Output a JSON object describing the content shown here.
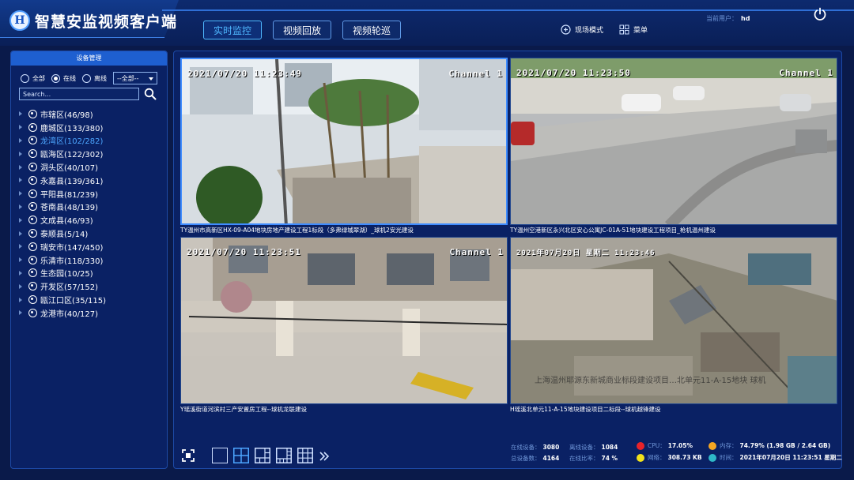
{
  "header": {
    "logo_letter": "H",
    "title": "智慧安监视频客户端",
    "tabs": [
      {
        "label": "实时监控",
        "active": true
      },
      {
        "label": "视频回放",
        "active": false
      },
      {
        "label": "视频轮巡",
        "active": false
      }
    ],
    "scene_mode": "现场模式",
    "menu": "菜单",
    "current_user_label": "当前用户：",
    "current_user": "hd"
  },
  "sidebar": {
    "title": "设备管理",
    "filters": [
      {
        "label": "全部",
        "selected": false
      },
      {
        "label": "在线",
        "selected": true
      },
      {
        "label": "离线",
        "selected": false
      }
    ],
    "select_value": "--全部--",
    "search_placeholder": "Search...",
    "tree": [
      {
        "label": "市辖区(46/98)",
        "selected": false
      },
      {
        "label": "鹿城区(133/380)",
        "selected": false
      },
      {
        "label": "龙湾区(102/282)",
        "selected": true
      },
      {
        "label": "瓯海区(122/302)",
        "selected": false
      },
      {
        "label": "洞头区(40/107)",
        "selected": false
      },
      {
        "label": "永嘉县(139/361)",
        "selected": false
      },
      {
        "label": "平阳县(81/239)",
        "selected": false
      },
      {
        "label": "苍南县(48/139)",
        "selected": false
      },
      {
        "label": "文成县(46/93)",
        "selected": false
      },
      {
        "label": "泰顺县(5/14)",
        "selected": false
      },
      {
        "label": "瑞安市(147/450)",
        "selected": false
      },
      {
        "label": "乐清市(118/330)",
        "selected": false
      },
      {
        "label": "生态园(10/25)",
        "selected": false
      },
      {
        "label": "开发区(57/152)",
        "selected": false
      },
      {
        "label": "瓯江口区(35/115)",
        "selected": false
      },
      {
        "label": "龙港市(40/127)",
        "selected": false
      }
    ]
  },
  "cameras": [
    {
      "time": "2021/07/20 11:23:49",
      "channel": "Channel 1",
      "caption": "TY温州市高新区HX-09-A04地块房地产建设工程1标段（多弗绿城翠湖）_球机2安光建设",
      "active": true
    },
    {
      "time": "2021/07/20 11:23:50",
      "channel": "Channel 1",
      "caption": "TY温州空港新区永兴北区安心公寓JC-01A-51地块建设工程项目_枪机温州建设",
      "active": false
    },
    {
      "time": "2021/07/20 11:23:51",
      "channel": "Channel 1",
      "caption": "Y瑶溪街道河滨村三产安置房工程--球机龙联建设",
      "active": false
    },
    {
      "time": "2021年07月20日 星期二 11:23:46",
      "channel": "",
      "caption": "H瑶溪北单元11-A-15地块建设项目二标段--球机越锋建设",
      "active": false,
      "watermark": "上海温州耶源东新城商业标段建设项目…北单元11-A-15地块 球机"
    }
  ],
  "stats": {
    "online_label": "在线设备：",
    "online": "3080",
    "offline_label": "离线设备：",
    "offline": "1084",
    "total_label": "总设备数：",
    "total": "4164",
    "rate_label": "在线比率：",
    "rate": "74 %",
    "cpu_label": "CPU：",
    "cpu": "17.05%",
    "net_label": "网络：",
    "net": "308.73 KB",
    "mem_label": "内存：",
    "mem": "74.79% (1.98 GB / 2.64 GB)",
    "time_label": "时间：",
    "time": "2021年07月20日 11:23:51 星期二",
    "colors": {
      "cpu": "#e8232a",
      "net": "#f2e21a",
      "mem": "#f5a623",
      "time": "#2fb8c8"
    }
  }
}
